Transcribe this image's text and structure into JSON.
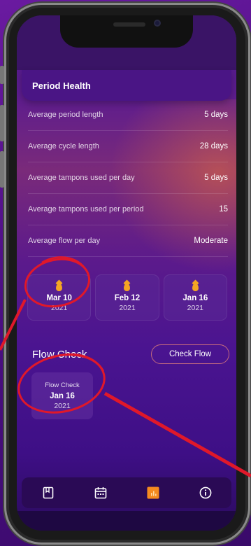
{
  "header": {
    "title": "Period Health"
  },
  "stats": [
    {
      "label": "Average period length",
      "value": "5 days"
    },
    {
      "label": "Average cycle length",
      "value": "28 days"
    },
    {
      "label": "Average tampons used per day",
      "value": "5 days"
    },
    {
      "label": "Average tampons used per period",
      "value": "15"
    },
    {
      "label": "Average flow per day",
      "value": "Moderate"
    }
  ],
  "periods": [
    {
      "date": "Mar 10",
      "year": "2021"
    },
    {
      "date": "Feb 12",
      "year": "2021"
    },
    {
      "date": "Jan 16",
      "year": "2021"
    }
  ],
  "flow": {
    "title": "Flow Check",
    "button": "Check Flow",
    "card": {
      "label": "Flow Check",
      "date": "Jan 16",
      "year": "2021"
    }
  },
  "nav": [
    {
      "icon": "journal-icon"
    },
    {
      "icon": "calendar-icon"
    },
    {
      "icon": "chart-icon",
      "active": true
    },
    {
      "icon": "info-icon"
    }
  ],
  "colors": {
    "accent": "#f5a623",
    "annotation": "#e0182a",
    "header": "#4a1585"
  }
}
